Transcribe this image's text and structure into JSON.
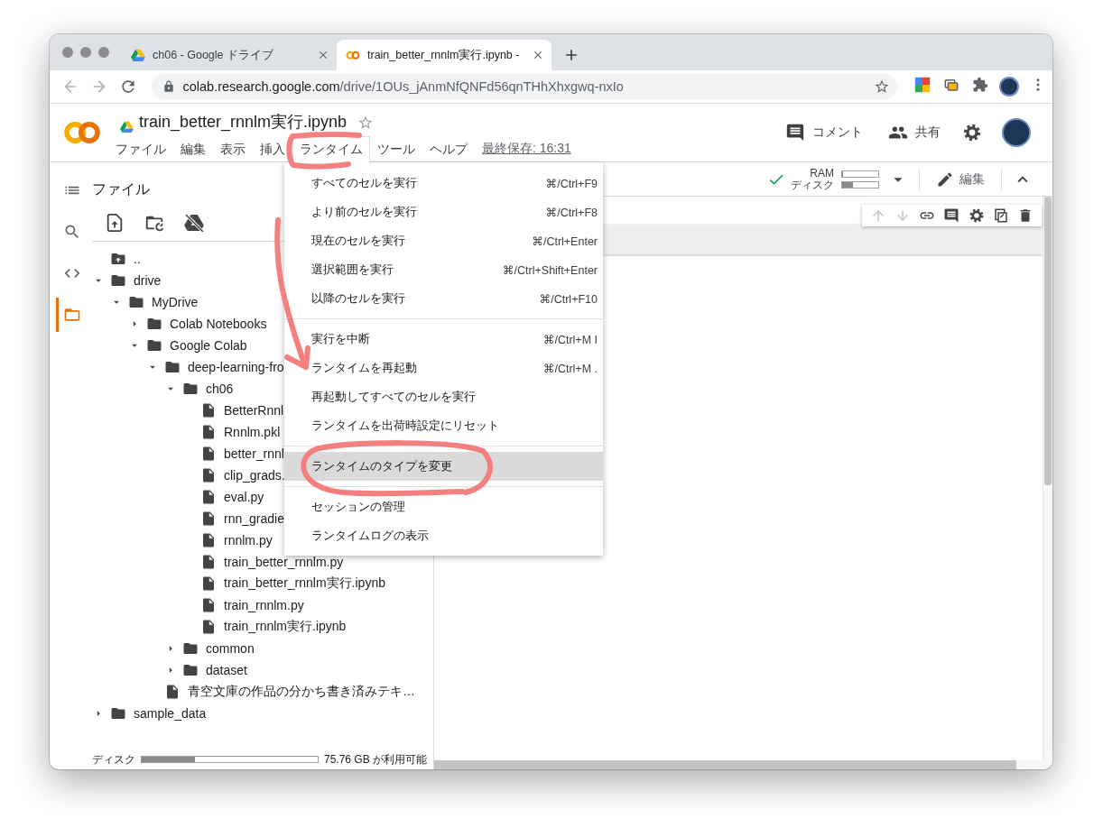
{
  "browser": {
    "tabs": [
      {
        "title": "ch06 - Google ドライブ",
        "selected": false
      },
      {
        "title": "train_better_rnnlm実行.ipynb -",
        "selected": true
      }
    ],
    "url": {
      "host": "colab.research.google.com",
      "path": "/drive/1OUs_jAnmNfQNFd56qnTHhXhxgwq-nxIo"
    }
  },
  "notebook_header": {
    "title": "train_better_rnnlm実行.ipynb",
    "menu": [
      {
        "label": "ファイル",
        "selected": false
      },
      {
        "label": "編集",
        "selected": false
      },
      {
        "label": "表示",
        "selected": false
      },
      {
        "label": "挿入",
        "selected": false
      },
      {
        "label": "ランタイム",
        "selected": true
      },
      {
        "label": "ツール",
        "selected": false
      },
      {
        "label": "ヘルプ",
        "selected": false
      }
    ],
    "last_saved": "最終保存: 16:31",
    "actions": [
      {
        "label": "コメント"
      },
      {
        "label": "共有"
      }
    ]
  },
  "runtime_menu": {
    "groups": [
      {
        "items": [
          {
            "label": "すべてのセルを実行",
            "shortcut": "⌘/Ctrl+F9",
            "selected": false
          },
          {
            "label": "より前のセルを実行",
            "shortcut": "⌘/Ctrl+F8",
            "selected": false
          },
          {
            "label": "現在のセルを実行",
            "shortcut": "⌘/Ctrl+Enter",
            "selected": false
          },
          {
            "label": "選択範囲を実行",
            "shortcut": "⌘/Ctrl+Shift+Enter",
            "selected": false
          },
          {
            "label": "以降のセルを実行",
            "shortcut": "⌘/Ctrl+F10",
            "selected": false
          }
        ]
      },
      {
        "items": [
          {
            "label": "実行を中断",
            "shortcut": "⌘/Ctrl+M I",
            "selected": false
          },
          {
            "label": "ランタイムを再起動",
            "shortcut": "⌘/Ctrl+M .",
            "selected": false
          },
          {
            "label": "再起動してすべてのセルを実行",
            "selected": false
          },
          {
            "label": "ランタイムを出荷時設定にリセット",
            "selected": false
          }
        ]
      },
      {
        "items": [
          {
            "label": "ランタイムのタイプを変更",
            "selected": true
          }
        ]
      },
      {
        "items": [
          {
            "label": "セッションの管理",
            "selected": false
          },
          {
            "label": "ランタイムログの表示",
            "selected": false
          }
        ]
      }
    ]
  },
  "toolbar": {
    "meters": [
      {
        "label": "RAM",
        "level": 0.02
      },
      {
        "label": "ディスク",
        "level": 0.3
      }
    ],
    "edit_label": "編集"
  },
  "rail": [
    {
      "selected": false
    },
    {
      "selected": false
    },
    {
      "selected": false
    },
    {
      "selected": true
    }
  ],
  "files_panel": {
    "title": "ファイル",
    "tree": [
      {
        "name": "..",
        "kind": "parent"
      },
      {
        "name": "drive",
        "kind": "folder",
        "expanded": true,
        "children": [
          {
            "name": "MyDrive",
            "kind": "folder",
            "expanded": true,
            "children": [
              {
                "name": "Colab Notebooks",
                "kind": "folder",
                "expanded": false
              },
              {
                "name": "Google Colab",
                "kind": "folder",
                "expanded": true,
                "children": [
                  {
                    "name": "deep-learning-fro",
                    "kind": "folder",
                    "expanded": true,
                    "children": [
                      {
                        "name": "ch06",
                        "kind": "folder",
                        "expanded": true,
                        "children": [
                          {
                            "name": "BetterRnnl",
                            "kind": "file"
                          },
                          {
                            "name": "Rnnlm.pkl",
                            "kind": "file"
                          },
                          {
                            "name": "better_rnnl",
                            "kind": "file"
                          },
                          {
                            "name": "clip_grads.",
                            "kind": "file"
                          },
                          {
                            "name": "eval.py",
                            "kind": "file"
                          },
                          {
                            "name": "rnn_gradie",
                            "kind": "file"
                          },
                          {
                            "name": "rnnlm.py",
                            "kind": "file"
                          },
                          {
                            "name": "train_better_rnnlm.py",
                            "kind": "file"
                          },
                          {
                            "name": "train_better_rnnlm実行.ipynb",
                            "kind": "file"
                          },
                          {
                            "name": "train_rnnlm.py",
                            "kind": "file"
                          },
                          {
                            "name": "train_rnnlm実行.ipynb",
                            "kind": "file"
                          }
                        ]
                      },
                      {
                        "name": "common",
                        "kind": "folder",
                        "expanded": false
                      },
                      {
                        "name": "dataset",
                        "kind": "folder",
                        "expanded": false
                      }
                    ]
                  },
                  {
                    "name": "青空文庫の作品の分かち書き済みテキ…",
                    "kind": "file"
                  }
                ]
              }
            ]
          }
        ]
      },
      {
        "name": "sample_data",
        "kind": "folder",
        "expanded": false
      }
    ],
    "disk": {
      "label": "ディスク",
      "level": 0.3,
      "free": "75.76 GB が利用可能"
    }
  },
  "annotations": [
    {
      "kind": "circle"
    },
    {
      "kind": "arrow"
    },
    {
      "kind": "oval"
    }
  ]
}
